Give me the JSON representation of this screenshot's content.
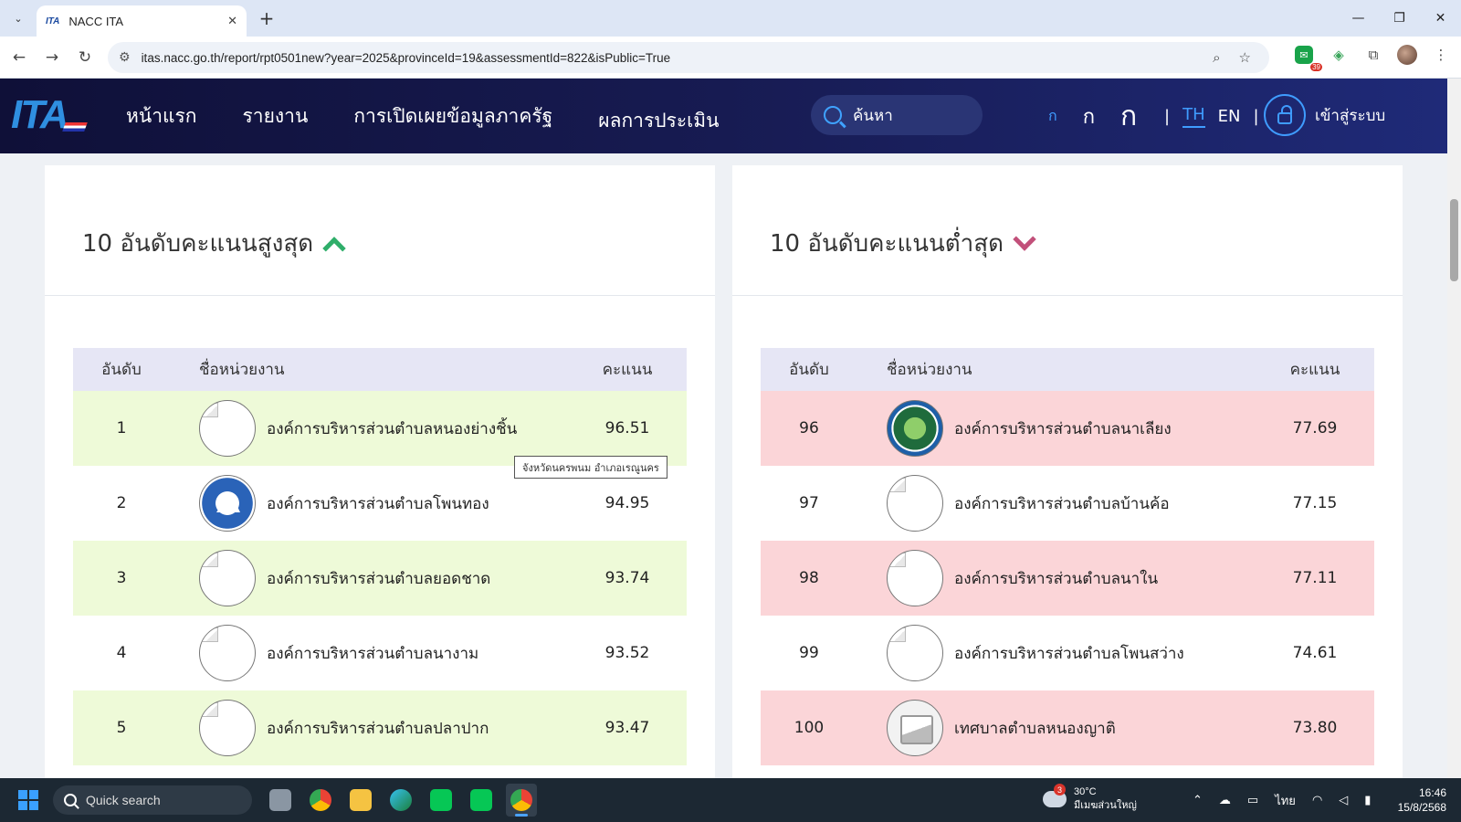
{
  "browser": {
    "tab_title": "NACC ITA",
    "tab_favicon": "ITA",
    "url": "itas.nacc.go.th/report/rpt0501new?year=2025&provinceId=19&assessmentId=822&isPublic=True",
    "extension_badge": "39",
    "icons": [
      "tab-dropdown-icon",
      "close-icon",
      "plus-icon",
      "minimize-icon",
      "maximize-icon",
      "close-window-icon",
      "back-icon",
      "forward-icon",
      "reload-icon",
      "site-info-icon",
      "zoom-icon",
      "star-icon",
      "extensions-icon",
      "menu-icon"
    ]
  },
  "site": {
    "logo": "ITA",
    "nav": [
      "หน้าแรก",
      "รายงาน",
      "การเปิดเผยข้อมูลภาครัฐ",
      "ผลการประเมิน"
    ],
    "search_placeholder": "ค้นหา",
    "font_sizes": [
      "ก",
      "ก",
      "ก"
    ],
    "lang_th": "TH",
    "lang_en": "EN",
    "login": "เข้าสู่ระบบ",
    "accent_color": "#3f9cff"
  },
  "top10": {
    "title": "10 อันดับคะแนนสูงสุด",
    "col_rank": "อันดับ",
    "col_name": "ชื่อหน่วยงาน",
    "col_score": "คะแนน",
    "row_color": "#eefad8",
    "rows": [
      {
        "rank": "1",
        "name": "องค์การบริหารส่วนตำบลหนองย่างชิ้น",
        "score": "96.51",
        "logo": "broken"
      },
      {
        "rank": "2",
        "name": "องค์การบริหารส่วนตำบลโพนทอง",
        "score": "94.95",
        "logo": "blue-seal"
      },
      {
        "rank": "3",
        "name": "องค์การบริหารส่วนตำบลยอดชาด",
        "score": "93.74",
        "logo": "broken"
      },
      {
        "rank": "4",
        "name": "องค์การบริหารส่วนตำบลนางาม",
        "score": "93.52",
        "logo": "broken"
      },
      {
        "rank": "5",
        "name": "องค์การบริหารส่วนตำบลปลาปาก",
        "score": "93.47",
        "logo": "broken"
      }
    ],
    "tooltip": "จังหวัดนครพนม อำเภอเรณูนคร"
  },
  "bottom10": {
    "title": "10 อันดับคะแนนต่ำสุด",
    "col_rank": "อันดับ",
    "col_name": "ชื่อหน่วยงาน",
    "col_score": "คะแนน",
    "row_color": "#fbd5d8",
    "rows": [
      {
        "rank": "96",
        "name": "องค์การบริหารส่วนตำบลนาเลียง",
        "score": "77.69",
        "logo": "green-seal"
      },
      {
        "rank": "97",
        "name": "องค์การบริหารส่วนตำบลบ้านค้อ",
        "score": "77.15",
        "logo": "broken"
      },
      {
        "rank": "98",
        "name": "องค์การบริหารส่วนตำบลนาใน",
        "score": "77.11",
        "logo": "broken"
      },
      {
        "rank": "99",
        "name": "องค์การบริหารส่วนตำบลโพนสว่าง",
        "score": "74.61",
        "logo": "broken"
      },
      {
        "rank": "100",
        "name": "เทศบาลตำบลหนองญาติ",
        "score": "73.80",
        "logo": "placeholder"
      }
    ]
  },
  "taskbar": {
    "search_placeholder": "Quick search",
    "weather_temp": "30°C",
    "weather_desc": "มีเมฆส่วนใหญ่",
    "weather_badge": "3",
    "lang": "ไทย",
    "time": "16:46",
    "date": "15/8/2568"
  }
}
